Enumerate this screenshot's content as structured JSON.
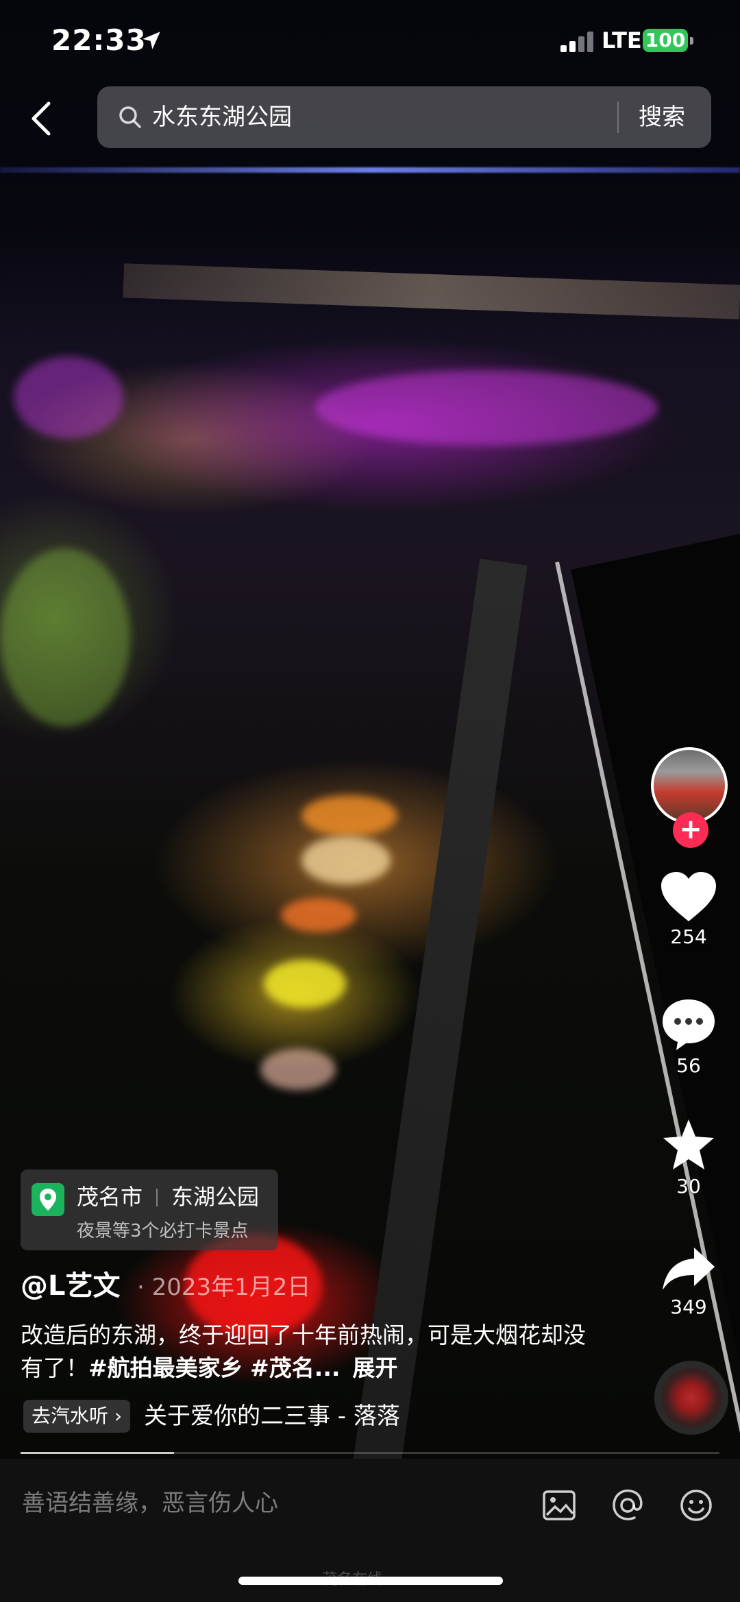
{
  "status_bar": {
    "time": "22:33",
    "network": "LTE",
    "battery": "100"
  },
  "search": {
    "query": "水东东湖公园",
    "button_label": "搜索"
  },
  "actions": {
    "likes": "254",
    "comments": "56",
    "favorites": "30",
    "shares": "349",
    "follow_symbol": "+"
  },
  "poi": {
    "city": "茂名市",
    "place": "东湖公园",
    "subtitle": "夜景等3个必打卡景点"
  },
  "post": {
    "author": "@L艺文",
    "date": "· 2023年1月2日",
    "caption_text": "改造后的东湖，终于迎回了十年前热闹，可是大烟花却没有了！",
    "tag1": "#航拍最美家乡",
    "tag2": "#茂名...",
    "expand_label": "展开"
  },
  "music": {
    "qishui_label": "去汽水听 ›",
    "track": "关于爱你的二三事 - 落落"
  },
  "progress": {
    "fraction": 0.22
  },
  "comment_bar": {
    "placeholder": "善语结善缘，恶言伤人心"
  },
  "watermark": "茂名在线"
}
